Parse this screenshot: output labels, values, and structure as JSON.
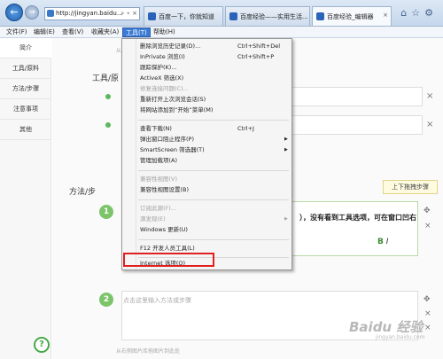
{
  "browser": {
    "address": "http://jingyan.baidu...",
    "address_icons": "⌕ ∘ ×",
    "back_glyph": "←",
    "forward_glyph": "→",
    "tabs": [
      {
        "label": "百度一下，你就知道"
      },
      {
        "label": "百度经验——实用生活..."
      },
      {
        "label": "百度经验_编辑器"
      }
    ],
    "tab_close": "×",
    "chrome_icons": "⌂☆⚙"
  },
  "menubar": {
    "items": [
      {
        "label": "文件(F)"
      },
      {
        "label": "编辑(E)"
      },
      {
        "label": "查看(V)"
      },
      {
        "label": "收藏夹(A)"
      },
      {
        "label": "工具(T)"
      },
      {
        "label": "帮助(H)"
      }
    ]
  },
  "leftnav": {
    "items": [
      {
        "label": "简介"
      },
      {
        "label": "工具/原料"
      },
      {
        "label": "方法/步骤"
      },
      {
        "label": "注意事项"
      },
      {
        "label": "其他"
      }
    ],
    "help": "?"
  },
  "content": {
    "upload_hint": "从右侧图片库拖图片到此处",
    "tools_label": "工具/原",
    "methods_label": "方法/步",
    "close": "×",
    "reorder_tip": "上下拖拽步骤",
    "step1_num": "1",
    "step1_text": "），没有看到工具选项，可在窗口凹右",
    "bold_btn": "B",
    "italic_btn": "I",
    "step2_num": "2",
    "step2_placeholder": "点击这里输入方法或步骤",
    "move_icon": "✥",
    "watermark": "Baidu 经验",
    "watermark_sub": "jingyan.baidu.com"
  },
  "tools_menu": {
    "items": [
      {
        "label": "删除浏览历史记录(D)...",
        "shortcut": "Ctrl+Shift+Del"
      },
      {
        "label": "InPrivate 浏览(I)",
        "shortcut": "Ctrl+Shift+P"
      },
      {
        "label": "跟踪保护(K)..."
      },
      {
        "label": "ActiveX 筛选(X)"
      },
      {
        "label": "修复连接问题(C)..."
      },
      {
        "label": "重新打开上次浏览会话(S)"
      },
      {
        "label": "将网站添加到“开始”菜单(M)"
      },
      {
        "label": "查看下载(N)",
        "shortcut": "Ctrl+J"
      },
      {
        "label": "弹出窗口阻止程序(P)"
      },
      {
        "label": "SmartScreen 筛选器(T)"
      },
      {
        "label": "管理加载项(A)"
      },
      {
        "label": "兼容性视图(V)"
      },
      {
        "label": "兼容性视图设置(B)"
      },
      {
        "label": "订阅此源(F)..."
      },
      {
        "label": "源发现(E)"
      },
      {
        "label": "Windows 更新(U)"
      },
      {
        "label": "F12 开发人员工具(L)"
      },
      {
        "label": "Internet 选项(O)"
      }
    ],
    "submenu_arrow": "▶"
  }
}
